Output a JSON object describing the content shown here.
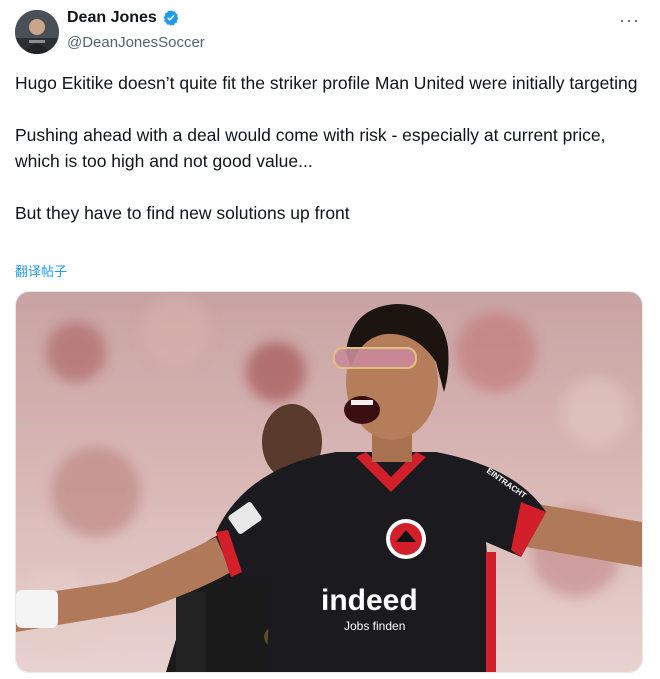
{
  "author": {
    "display_name": "Dean Jones",
    "handle": "@DeanJonesSoccer",
    "verified": true,
    "avatar_icon": "avatar-photo"
  },
  "actions": {
    "more_icon": "more-horizontal-icon",
    "more_label": "···"
  },
  "tweet": {
    "paragraphs": [
      "Hugo Ekitike doesn’t quite fit the striker profile Man United were initially targeting",
      "Pushing ahead with a deal would come with risk - especially at current price, which is too high and not good value...",
      "But they have to find new solutions up front"
    ],
    "translate_label": "翻译帖子"
  },
  "media": {
    "type": "photo",
    "sponsor_main": "indeed",
    "sponsor_sub": "Jobs finden",
    "sleeve_text": "EINTRACHT"
  },
  "colors": {
    "accent": "#1d9bf0",
    "text": "#0f1419",
    "secondary": "#536471"
  }
}
